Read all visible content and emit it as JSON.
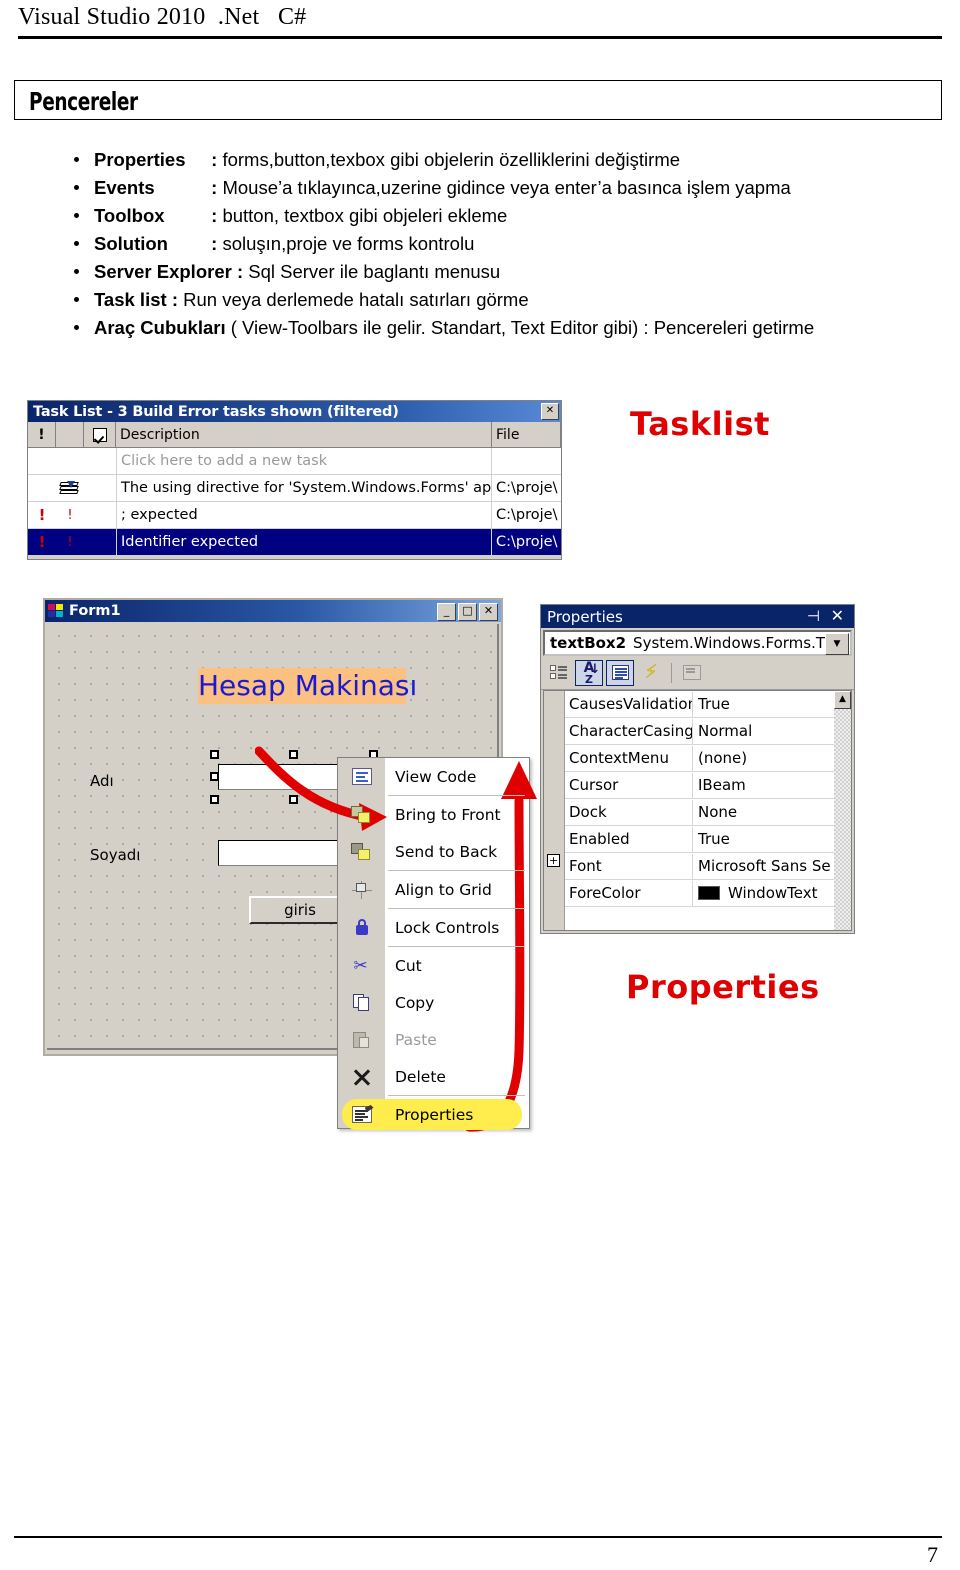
{
  "header": {
    "title": "Visual Studio 2010  .Net   C#"
  },
  "section": {
    "title": "Pencereler"
  },
  "bullets": [
    {
      "term": "Properties",
      "sep": ":",
      "rest": "forms,button,texbox gibi objelerin özelliklerini değiştirme"
    },
    {
      "term": "Events",
      "sep": ":",
      "rest": "Mouse’a tıklayınca,uzerine gidince veya enter’a basınca işlem yapma"
    },
    {
      "term": "Toolbox",
      "sep": ":",
      "rest": "button, textbox gibi objeleri ekleme"
    },
    {
      "term": "Solution",
      "sep": ":",
      "rest": "soluşın,proje ve forms kontrolu"
    },
    {
      "term": "Server Explorer",
      "sep": ":",
      "rest": "Sql Server ile baglantı menusu"
    },
    {
      "term": "Task list",
      "sep": ":",
      "rest": "Run veya derlemede hatalı satırları görme"
    },
    {
      "term": "Araç Cubukları",
      "sep": "",
      "rest": "( View-Toolbars  ile gelir. Standart, Text Editor  gibi) : Pencereleri getirme"
    }
  ],
  "tasklist": {
    "title": "Task List - 3 Build Error tasks shown (filtered)",
    "close_label": "✕",
    "columns": {
      "bang": "!",
      "icon": "",
      "check": "",
      "description": "Description",
      "file": "File"
    },
    "new_task_hint": "Click here to add a new task",
    "rows": [
      {
        "bang": "",
        "icon": "stack",
        "description": "The using directive for 'System.Windows.Forms' app",
        "file": "C:\\proje\\",
        "selected": false
      },
      {
        "bang": "!",
        "icon": "bang-thin",
        "description": "; expected",
        "file": "C:\\proje\\",
        "selected": false
      },
      {
        "bang": "!",
        "icon": "bang-thin",
        "description": "Identifier expected",
        "file": "C:\\proje\\",
        "selected": true
      }
    ]
  },
  "labels": {
    "tasklist": "Tasklist",
    "properties": "Properties"
  },
  "form1": {
    "title": "Form1",
    "buttons": {
      "minimize": "_",
      "maximize": "□",
      "close": "✕"
    },
    "heading": "Hesap Makinası",
    "label_adi": "Adı",
    "label_soyadi": "Soyadı",
    "textbox_adi": "",
    "textbox_soyadi": "",
    "button_giris": "giris"
  },
  "context_menu": {
    "items": [
      {
        "label": "View Code",
        "icon": "view-code-icon",
        "disabled": false,
        "highlight": false,
        "sep_after": true
      },
      {
        "label": "Bring to Front",
        "icon": "bring-to-front-icon",
        "disabled": false,
        "highlight": false,
        "sep_after": false
      },
      {
        "label": "Send to Back",
        "icon": "send-to-back-icon",
        "disabled": false,
        "highlight": false,
        "sep_after": true
      },
      {
        "label": "Align to Grid",
        "icon": "align-to-grid-icon",
        "disabled": false,
        "highlight": false,
        "sep_after": true
      },
      {
        "label": "Lock Controls",
        "icon": "lock-icon",
        "disabled": false,
        "highlight": false,
        "sep_after": true
      },
      {
        "label": "Cut",
        "icon": "cut-icon",
        "disabled": false,
        "highlight": false,
        "sep_after": false
      },
      {
        "label": "Copy",
        "icon": "copy-icon",
        "disabled": false,
        "highlight": false,
        "sep_after": false
      },
      {
        "label": "Paste",
        "icon": "paste-icon",
        "disabled": true,
        "highlight": false,
        "sep_after": false
      },
      {
        "label": "Delete",
        "icon": "delete-icon",
        "disabled": false,
        "highlight": false,
        "sep_after": true
      },
      {
        "label": "Properties",
        "icon": "properties-icon",
        "disabled": false,
        "highlight": true,
        "sep_after": false
      }
    ]
  },
  "properties_panel": {
    "title": "Properties",
    "pin_label": "⊣",
    "close_label": "✕",
    "combo_object": "textBox2",
    "combo_type": "System.Windows.Forms.T",
    "combo_arrow": "▼",
    "toolbar": {
      "categorized": "categorized-icon",
      "alphabetical": "alphabetical-sort-icon",
      "properties": "properties-list-icon",
      "events": "events-lightning-icon",
      "property_pages": "property-pages-icon"
    },
    "scroll_up": "▲",
    "rows": [
      {
        "name": "CausesValidation",
        "value": "True",
        "expand": false,
        "swatch": null
      },
      {
        "name": "CharacterCasing",
        "value": "Normal",
        "expand": false,
        "swatch": null
      },
      {
        "name": "ContextMenu",
        "value": "(none)",
        "expand": false,
        "swatch": null
      },
      {
        "name": "Cursor",
        "value": "IBeam",
        "expand": false,
        "swatch": null
      },
      {
        "name": "Dock",
        "value": "None",
        "expand": false,
        "swatch": null
      },
      {
        "name": "Enabled",
        "value": "True",
        "expand": false,
        "swatch": null
      },
      {
        "name": "Font",
        "value": "Microsoft Sans Se",
        "expand": true,
        "swatch": null
      },
      {
        "name": "ForeColor",
        "value": "WindowText",
        "expand": false,
        "swatch": "#000000"
      }
    ]
  },
  "footer": {
    "page_number": "7"
  },
  "colors": {
    "accent_red": "#e00000",
    "titlebar_blue": "#0a246a",
    "selection_blue": "#000080",
    "highlight_yellow": "#ffec4d",
    "form_heading_bg": "#fbc182",
    "form_heading_fg": "#1a1ad0"
  }
}
